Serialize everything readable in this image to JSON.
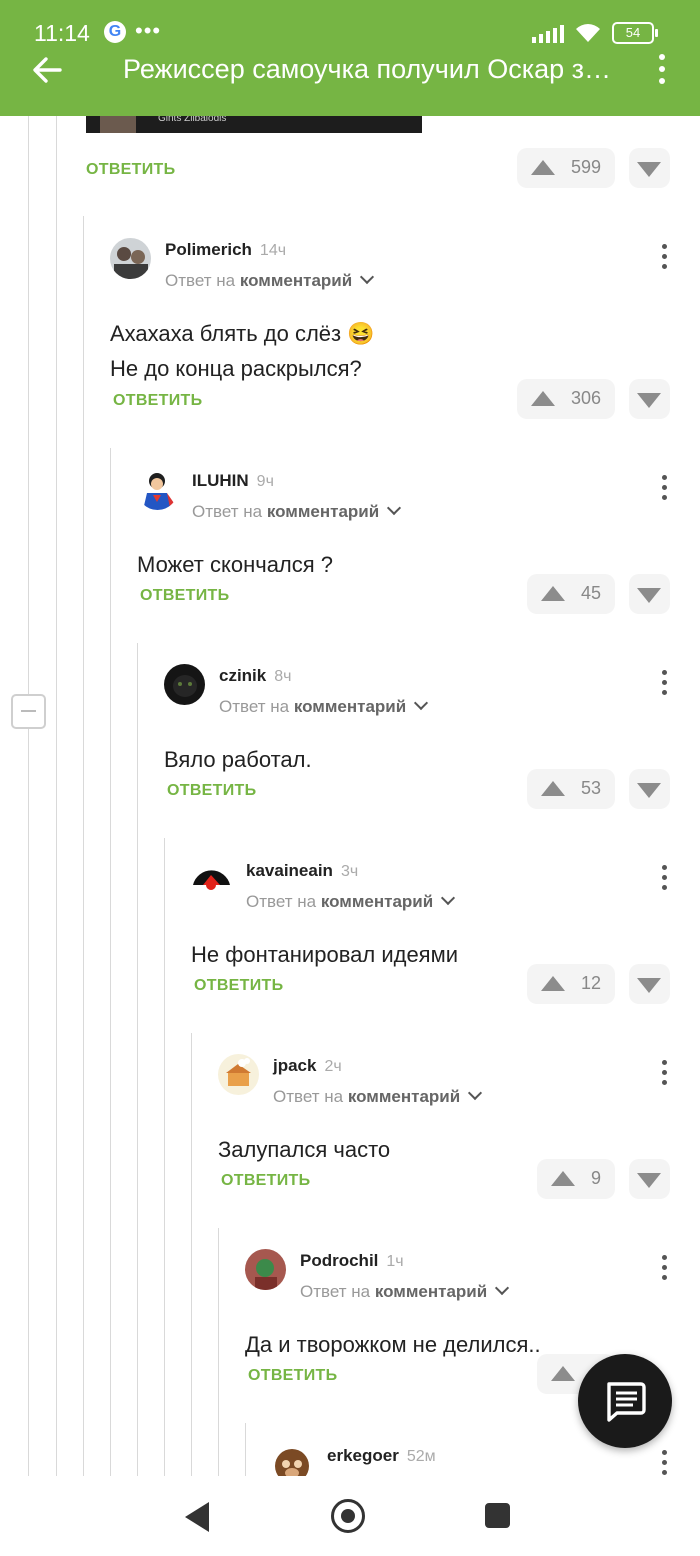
{
  "status_bar": {
    "time": "11:14",
    "g_letter": "G",
    "battery": "54"
  },
  "app_bar": {
    "title": "Режиссер самоучка получил Оскар за фильм, который сделал в программе для моделирования"
  },
  "image_caption": "Gints Zilbalodis",
  "top_actions": {
    "reply_label": "ОТВЕТИТЬ",
    "votes": "599"
  },
  "reply_to_prefix": "Ответ на",
  "reply_to_target": "комментарий",
  "reply_label": "ОТВЕТИТЬ",
  "comments": [
    {
      "user": "Polimerich",
      "time": "14ч",
      "lines": [
        "Ахахаха блять до слёз 😆",
        "Не до конца раскрылся?"
      ],
      "votes": "306"
    },
    {
      "user": "ILUHIN",
      "time": "9ч",
      "lines": [
        "Может скончался ?"
      ],
      "votes": "45"
    },
    {
      "user": "czinik",
      "time": "8ч",
      "lines": [
        "Вяло работал."
      ],
      "votes": "53"
    },
    {
      "user": "kavaineain",
      "time": "3ч",
      "lines": [
        "Не фонтанировал идеями"
      ],
      "votes": "12"
    },
    {
      "user": "jpack",
      "time": "2ч",
      "lines": [
        "Залупался часто"
      ],
      "votes": "9"
    },
    {
      "user": "Podrochil",
      "time": "1ч",
      "lines": [
        "Да и творожком не делился.."
      ],
      "votes": ""
    },
    {
      "user": "erkegoer",
      "time": "52м",
      "lines": [],
      "votes": ""
    }
  ],
  "icons": {
    "back": "arrow-left-icon",
    "overflow": "more-vert-icon",
    "upvote": "triangle-up-icon",
    "downvote": "triangle-down-icon",
    "collapse": "minus-box-icon",
    "fab": "comment-icon",
    "nav": [
      "nav-back-icon",
      "nav-home-icon",
      "nav-recents-icon"
    ]
  },
  "colors": {
    "accent": "#76b544",
    "text": "#222222",
    "muted": "#999999",
    "vote_bg": "#f4f4f4",
    "fab": "#1a1a1a"
  }
}
